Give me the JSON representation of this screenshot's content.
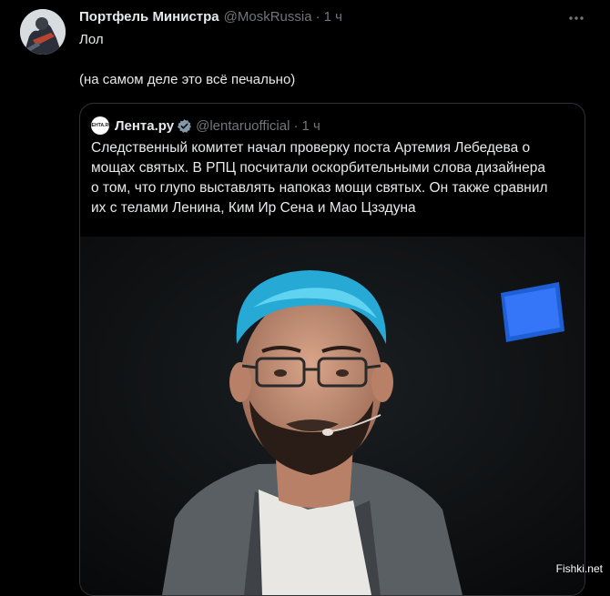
{
  "post": {
    "author_name": "Портфель Министра",
    "author_handle": "@MoskRussia",
    "separator": "·",
    "time": "1 ч",
    "more_icon": "more-horizontal-icon",
    "text_line1": "Лол",
    "text_line2": "(на самом деле это всё печально)"
  },
  "quoted": {
    "logo_text": "ЛЕНТА.RU",
    "author_name": "Лента.ру",
    "verified_icon": "verified-badge-icon",
    "author_handle": "@lentaruofficial",
    "separator": "·",
    "time": "1 ч",
    "text": "Следственный комитет начал проверку поста Артемия Лебедева о\nмощах святых.  В РПЦ посчитали оскорбительными слова дизайнера\nо том, что глупо выставлять напоказ мощи святых. Он также сравнил\nих с телами Ленина, Ким Ир Сена и Мао Цзэдуна"
  },
  "watermark": "Fishki.net",
  "colors": {
    "background": "#000000",
    "text": "#e7e9ea",
    "muted": "#71767b",
    "border": "#2f3336",
    "verified": "#829aab"
  }
}
